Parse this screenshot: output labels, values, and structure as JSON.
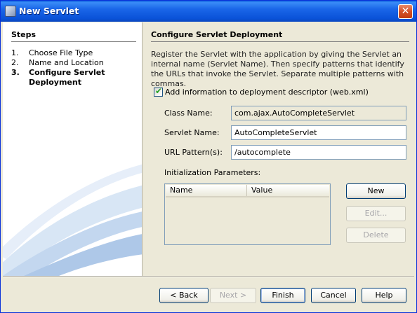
{
  "window": {
    "title": "New Servlet",
    "app_icon": "netbeans-cube-icon",
    "close_icon": "close-x-icon",
    "close_glyph": "✕"
  },
  "steps": {
    "title": "Steps",
    "items": [
      {
        "num": "1.",
        "label": "Choose File Type",
        "active": false
      },
      {
        "num": "2.",
        "label": "Name and Location",
        "active": false
      },
      {
        "num": "3.",
        "label": "Configure Servlet Deployment",
        "active": true
      }
    ]
  },
  "main": {
    "title": "Configure Servlet Deployment",
    "description": "Register the Servlet with the application by giving the Servlet an internal name (Servlet Name). Then specify patterns that identify the URLs that invoke the Servlet. Separate multiple patterns with commas.",
    "checkbox": {
      "label": "Add information to deployment descriptor (web.xml)",
      "checked": true,
      "glyph": "✔"
    },
    "class_name": {
      "label": "Class Name:",
      "value": "com.ajax.AutoCompleteServlet"
    },
    "servlet_name": {
      "label": "Servlet Name:",
      "value": "AutoCompleteServlet"
    },
    "url_pattern": {
      "label": "URL Pattern(s):",
      "value": "/autocomplete"
    },
    "init_params": {
      "label": "Initialization Parameters:",
      "columns": [
        "Name",
        "Value"
      ],
      "rows": []
    },
    "param_buttons": {
      "new": "New",
      "edit": "Edit...",
      "delete": "Delete"
    }
  },
  "footer": {
    "back": "< Back",
    "next": "Next >",
    "finish": "Finish",
    "cancel": "Cancel",
    "help": "Help"
  },
  "colors": {
    "titlebar": "#0a5ddd",
    "dialog_bg": "#ece9d8",
    "field_border": "#7f9db9",
    "close_button": "#d44f26"
  }
}
